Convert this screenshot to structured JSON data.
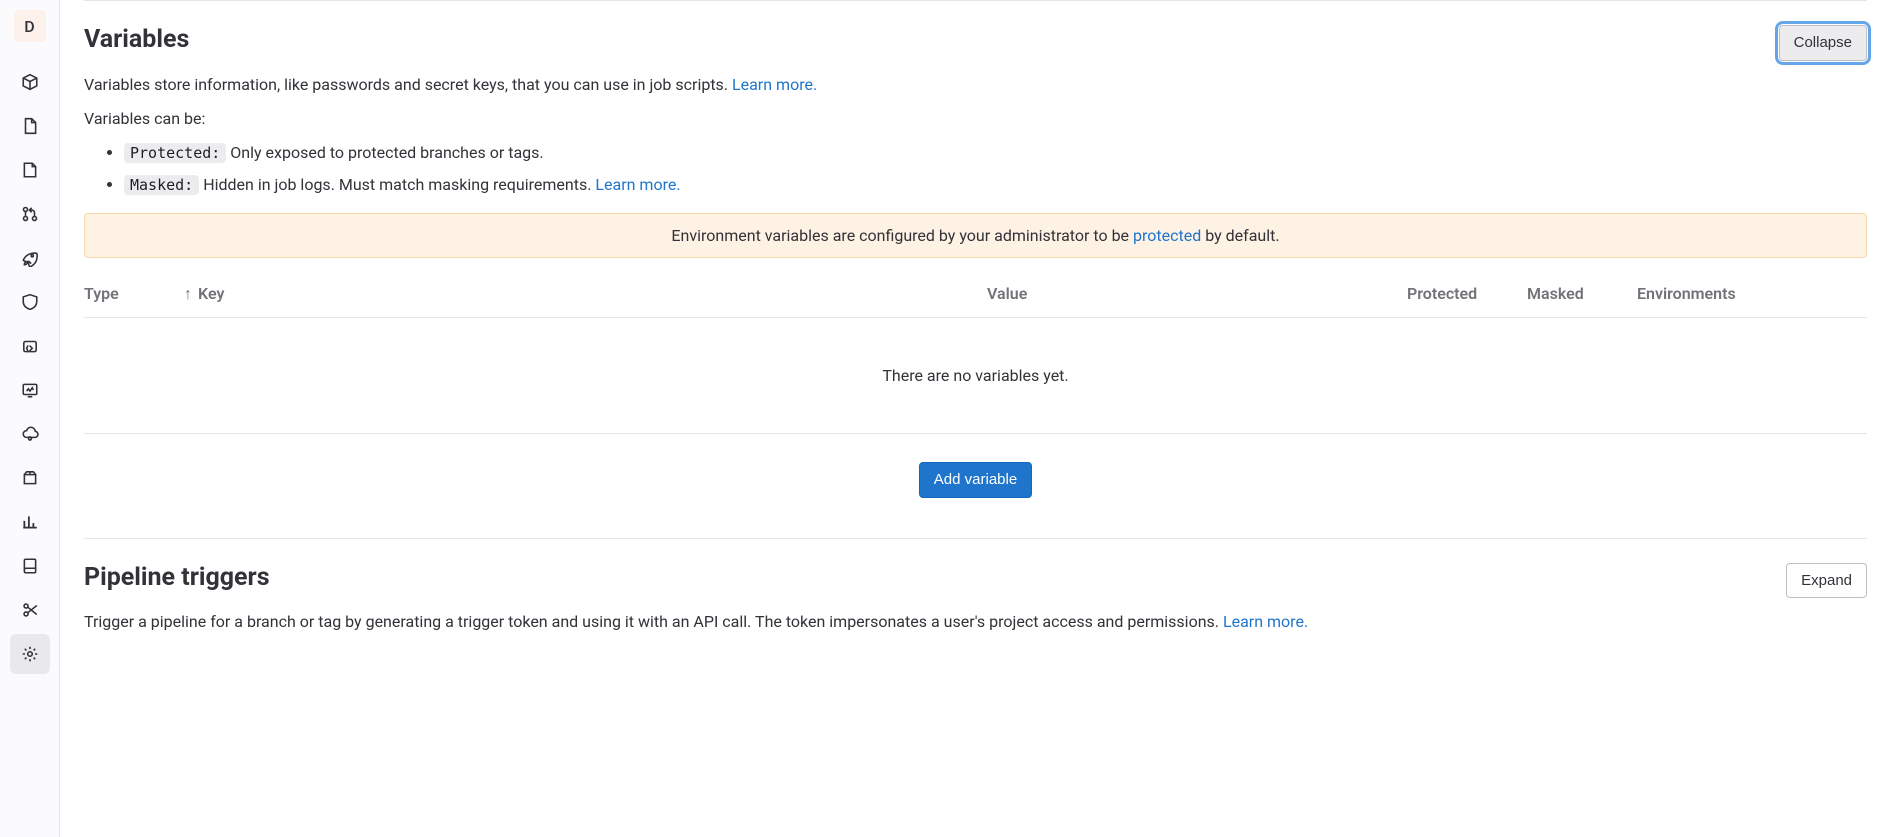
{
  "sidebar": {
    "avatar_letter": "D"
  },
  "variables_section": {
    "title": "Variables",
    "collapse_label": "Collapse",
    "desc_before_link": "Variables store information, like passwords and secret keys, that you can use in job scripts. ",
    "desc_link": "Learn more.",
    "can_be_text": "Variables can be:",
    "protected_code": "Protected:",
    "protected_text": " Only exposed to protected branches or tags.",
    "masked_code": "Masked:",
    "masked_text": " Hidden in job logs. Must match masking requirements. ",
    "masked_link": "Learn more.",
    "alert_before": "Environment variables are configured by your administrator to be ",
    "alert_link": "protected",
    "alert_after": " by default.",
    "columns": {
      "type": "Type",
      "key": "Key",
      "value": "Value",
      "protected": "Protected",
      "masked": "Masked",
      "environments": "Environments"
    },
    "empty_text": "There are no variables yet.",
    "add_button": "Add variable"
  },
  "triggers_section": {
    "title": "Pipeline triggers",
    "expand_label": "Expand",
    "desc_before_link": "Trigger a pipeline for a branch or tag by generating a trigger token and using it with an API call. The token impersonates a user's project access and permissions. ",
    "desc_link": "Learn more."
  }
}
